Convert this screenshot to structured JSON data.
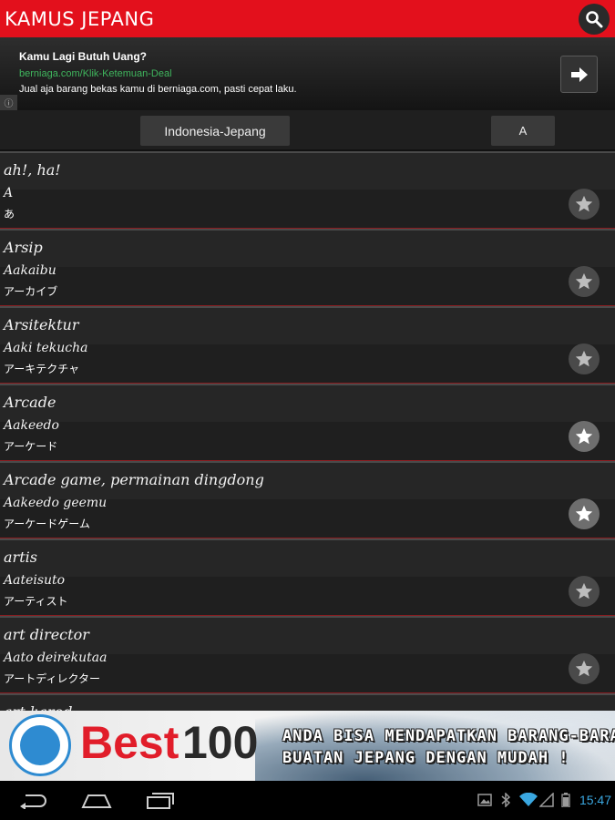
{
  "app": {
    "title": "KAMUS JEPANG",
    "accent_color": "#e3101c",
    "search_icon": "search-icon"
  },
  "ad": {
    "title": "Kamu Lagi Butuh Uang?",
    "url": "berniaga.com/Klik-Ketemuan-Deal",
    "text": "Jual aja barang bekas kamu di berniaga.com, pasti cepat laku.",
    "info_label": "ⓘ",
    "arrow_icon": "arrow-right-icon"
  },
  "filter": {
    "language": "Indonesia-Jepang",
    "letter": "A"
  },
  "entries": [
    {
      "word": "ah!, ha!",
      "romaji": "A",
      "kana": "あ",
      "favorite": false
    },
    {
      "word": "Arsip",
      "romaji": "Aakaibu",
      "kana": "アーカイブ",
      "favorite": false
    },
    {
      "word": "Arsitektur",
      "romaji": "Aaki tekucha",
      "kana": "アーキテクチャ",
      "favorite": false
    },
    {
      "word": "Arcade",
      "romaji": "Aakeedo",
      "kana": "アーケード",
      "favorite": true
    },
    {
      "word": "Arcade game, permainan dingdong",
      "romaji": "Aakeedo geemu",
      "kana": "アーケードゲーム",
      "favorite": true
    },
    {
      "word": "artis",
      "romaji": "Aateisuto",
      "kana": "アーティスト",
      "favorite": false
    },
    {
      "word": "art director",
      "romaji": "Aato deirekutaa",
      "kana": "アートディレクター",
      "favorite": false
    },
    {
      "word": "art karod",
      "romaji": "",
      "kana": "",
      "favorite": false
    }
  ],
  "banner": {
    "best": "Best",
    "number": "100",
    "line1": "ANDA BISA MENDAPATKAN BARANG-BARANG",
    "line2": "BUATAN JEPANG DENGAN MUDAH !"
  },
  "statusbar": {
    "time": "15:47",
    "icons": [
      "gallery-icon",
      "bluetooth-icon",
      "wifi-icon",
      "signal-icon",
      "battery-icon"
    ]
  }
}
